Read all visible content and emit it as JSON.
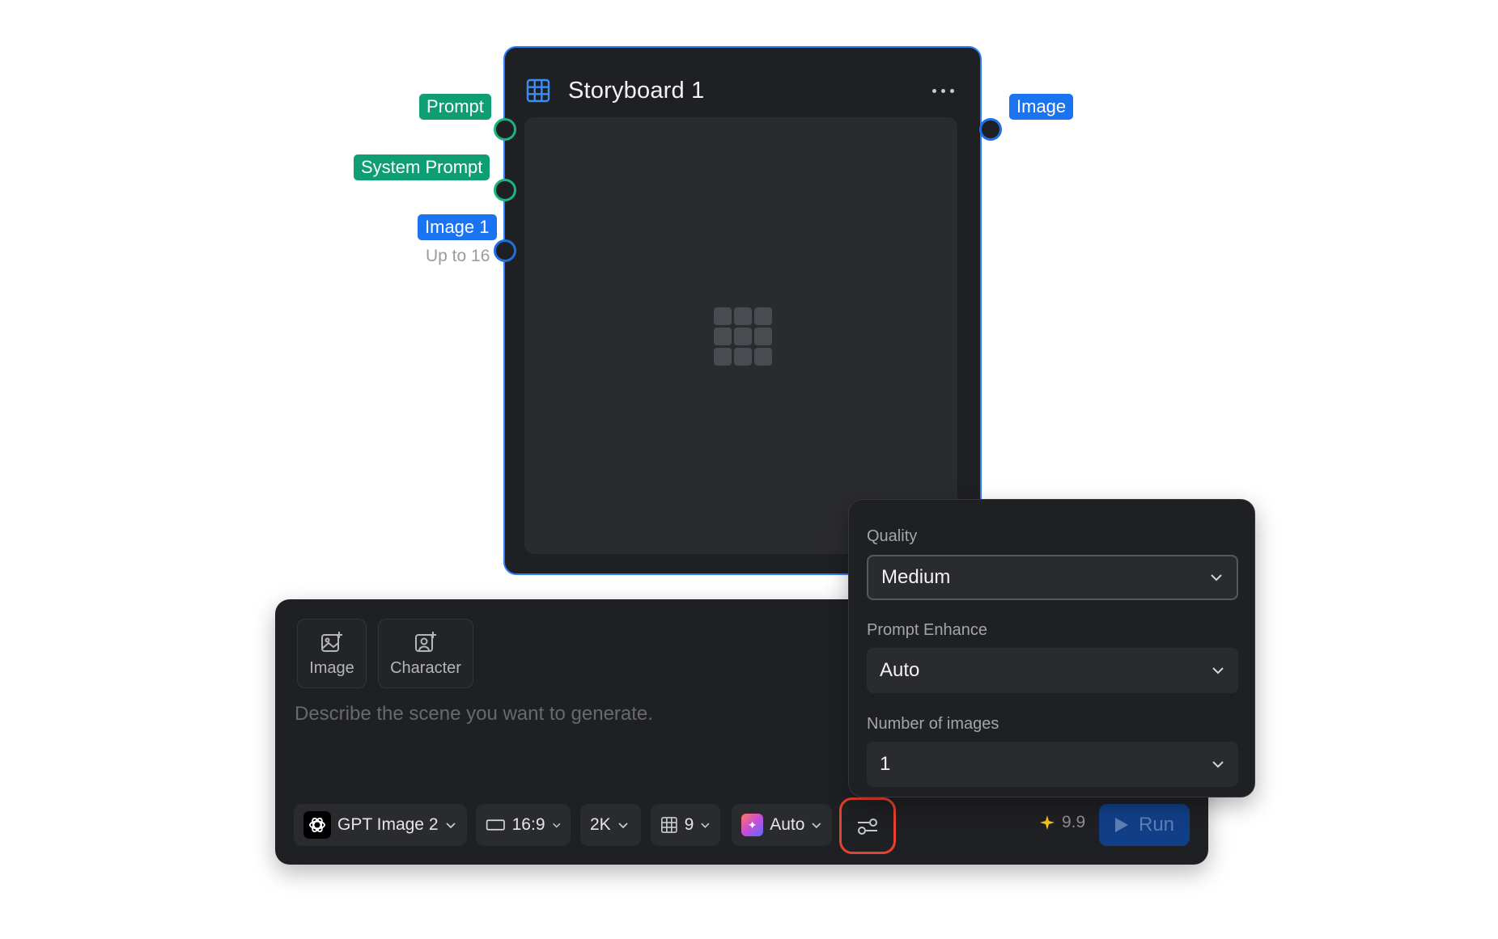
{
  "node": {
    "title": "Storyboard 1",
    "icon": "grid-icon",
    "inputs": [
      {
        "label": "Prompt",
        "color": "#0f9d74"
      },
      {
        "label": "System Prompt",
        "color": "#0f9d74"
      },
      {
        "label": "Image 1",
        "sublabel": "Up to 16",
        "color": "#1a73f0"
      }
    ],
    "output": {
      "label": "Image",
      "color": "#1a73f0"
    }
  },
  "panel": {
    "references": [
      {
        "label": "Image",
        "icon": "image-add-icon"
      },
      {
        "label": "Character",
        "icon": "character-add-icon"
      }
    ],
    "prompt_placeholder": "Describe the scene you want to generate.",
    "toolbar": {
      "model": "GPT Image 2",
      "aspect_ratio": "16:9",
      "resolution": "2K",
      "grid_count": "9",
      "style": "Auto",
      "credits": "9.9",
      "run_label": "Run"
    }
  },
  "settings": {
    "quality": {
      "label": "Quality",
      "value": "Medium"
    },
    "prompt_enhance": {
      "label": "Prompt Enhance",
      "value": "Auto"
    },
    "num_images": {
      "label": "Number of images",
      "value": "1"
    }
  },
  "colors": {
    "accent": "#2d7ff9",
    "highlight": "#e8412f",
    "credit_star": "#f5c518"
  }
}
